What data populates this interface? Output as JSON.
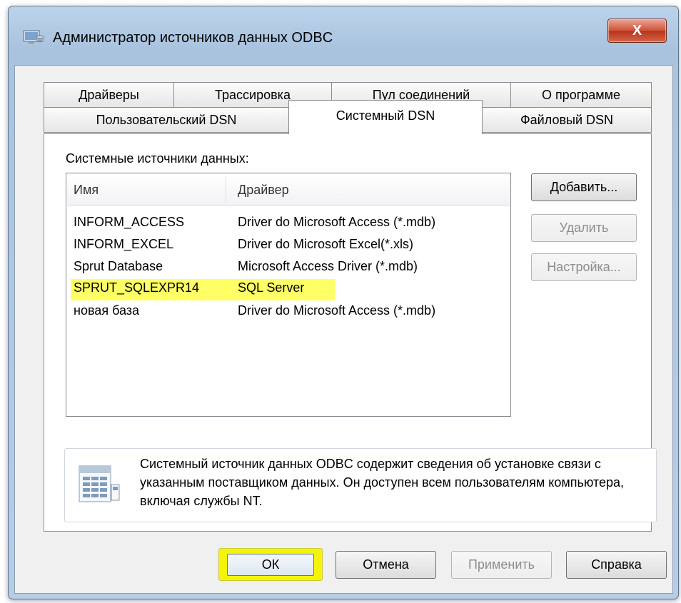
{
  "window": {
    "title": "Администратор источников данных ODBC",
    "close_glyph": "X"
  },
  "tabs_row1": [
    "Драйверы",
    "Трассировка",
    "Пул соединений",
    "О программе"
  ],
  "tabs_row2": [
    "Пользовательский DSN",
    "Системный DSN",
    "Файловый DSN"
  ],
  "active_tab": "Системный DSN",
  "panel": {
    "section_label": "Системные источники данных:",
    "columns": [
      "Имя",
      "Драйвер"
    ],
    "rows": [
      {
        "name": "INFORM_ACCESS",
        "driver": "Driver do Microsoft Access (*.mdb)",
        "highlighted": false
      },
      {
        "name": "INFORM_EXCEL",
        "driver": "Driver do Microsoft Excel(*.xls)",
        "highlighted": false
      },
      {
        "name": "Sprut Database",
        "driver": "Microsoft Access Driver (*.mdb)",
        "highlighted": false
      },
      {
        "name": "SPRUT_SQLEXPR14",
        "driver": "SQL Server",
        "highlighted": true
      },
      {
        "name": "новая база",
        "driver": "Driver do Microsoft Access (*.mdb)",
        "highlighted": false
      }
    ],
    "buttons": {
      "add": "Добавить...",
      "remove": "Удалить",
      "configure": "Настройка..."
    },
    "info_text": "Системный источник данных ODBC содержит сведения об установке связи с указанным поставщиком данных. Он доступен всем пользователям компьютера, включая службы NT."
  },
  "footer": {
    "ok": "ОК",
    "cancel": "Отмена",
    "apply": "Применить",
    "help": "Справка"
  },
  "colors": {
    "highlight": "#ffff66",
    "ok_highlight": "#f4f40a"
  }
}
